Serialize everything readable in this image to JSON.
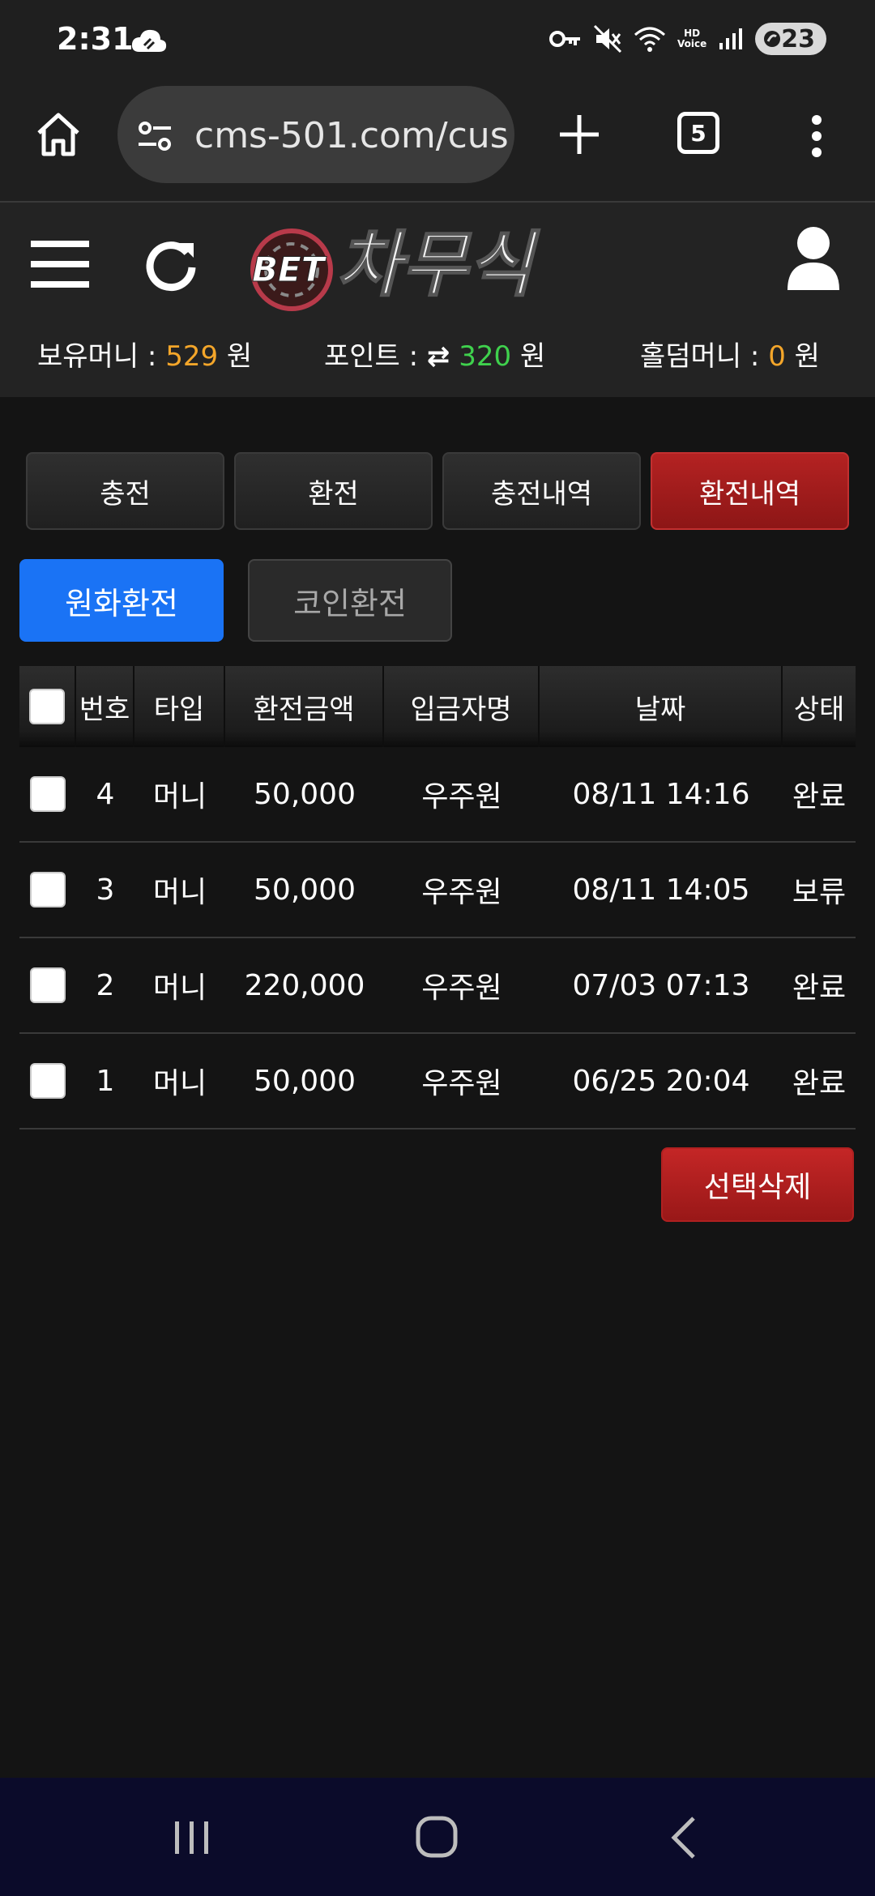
{
  "status_bar": {
    "time": "2:31",
    "battery": "23",
    "hd_top": "HD",
    "hd_bottom": "Voice"
  },
  "browser": {
    "url": "cms-501.com/cus",
    "tab_count": "5"
  },
  "header": {
    "logo_small": "BET",
    "logo_big": "차무식",
    "balances": [
      {
        "label": "보유머니 : ",
        "value": "529",
        "unit": " 원",
        "color": "#f4a62a"
      },
      {
        "label": "포인트 : ",
        "icon": "⇄",
        "value": "320",
        "unit": " 원",
        "color": "#3fd14d"
      },
      {
        "label": "홀덤머니 : ",
        "value": "0",
        "unit": " 원",
        "color": "#f4a62a"
      }
    ]
  },
  "main_tabs": [
    {
      "label": "충전",
      "active": false
    },
    {
      "label": "환전",
      "active": false
    },
    {
      "label": "충전내역",
      "active": false
    },
    {
      "label": "환전내역",
      "active": true
    }
  ],
  "sub_tabs": [
    {
      "label": "원화환전",
      "active": true
    },
    {
      "label": "코인환전",
      "active": false
    }
  ],
  "table": {
    "headers": [
      "번호",
      "타입",
      "환전금액",
      "입금자명",
      "날짜",
      "상태"
    ],
    "rows": [
      {
        "no": "4",
        "type": "머니",
        "amount": "50,000",
        "depositor": "우주원",
        "date": "08/11 14:16",
        "status": "완료"
      },
      {
        "no": "3",
        "type": "머니",
        "amount": "50,000",
        "depositor": "우주원",
        "date": "08/11 14:05",
        "status": "보류"
      },
      {
        "no": "2",
        "type": "머니",
        "amount": "220,000",
        "depositor": "우주원",
        "date": "07/03 07:13",
        "status": "완료"
      },
      {
        "no": "1",
        "type": "머니",
        "amount": "50,000",
        "depositor": "우주원",
        "date": "06/25 20:04",
        "status": "완료"
      }
    ]
  },
  "delete_button": "선택삭제"
}
